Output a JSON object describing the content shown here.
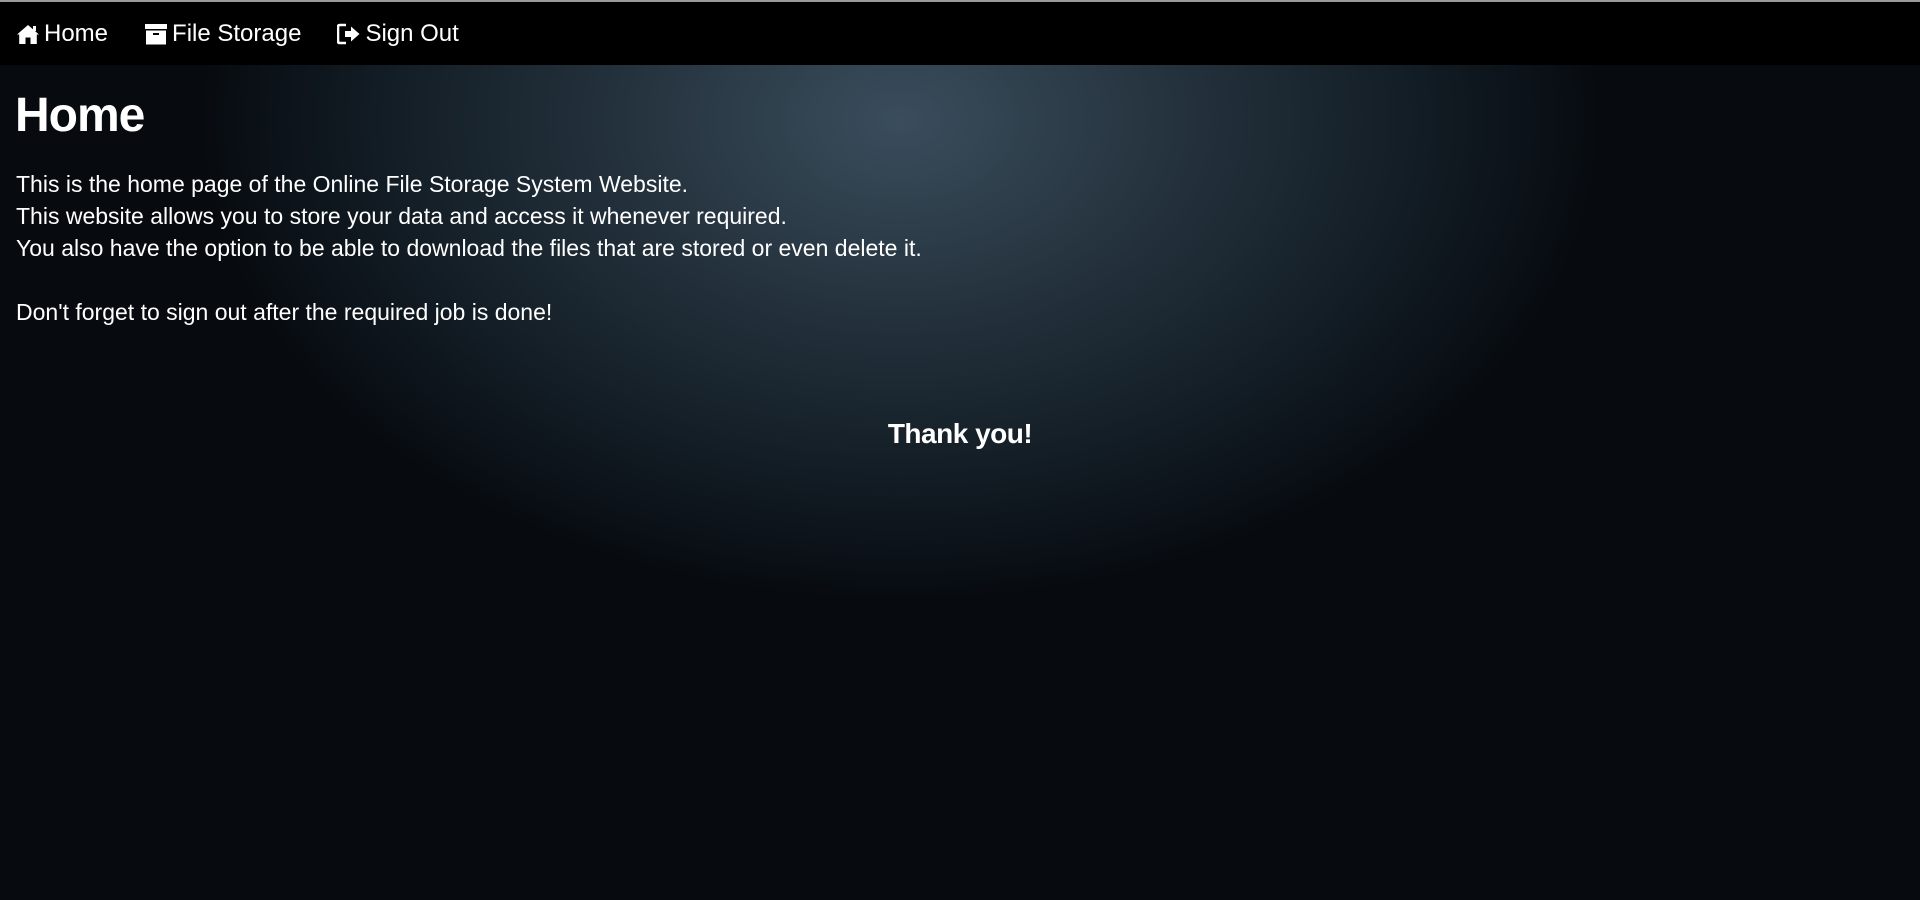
{
  "nav": {
    "items": [
      {
        "label": "Home",
        "icon": "home-icon"
      },
      {
        "label": "File Storage",
        "icon": "archive-icon"
      },
      {
        "label": "Sign Out",
        "icon": "sign-out-icon"
      }
    ]
  },
  "main": {
    "title": "Home",
    "intro_lines": [
      "This is the home page of the Online File Storage System Website.",
      "This website allows you to store your data and access it whenever required.",
      "You also have the option to be able to download the files that are stored or even delete it."
    ],
    "reminder": "Don't forget to sign out after the required job is done!",
    "thanks": "Thank you!"
  },
  "colors": {
    "navbar_background": "#000000",
    "text": "#ffffff",
    "background_center": "#3a4d5c",
    "background_edge": "#070b10"
  }
}
